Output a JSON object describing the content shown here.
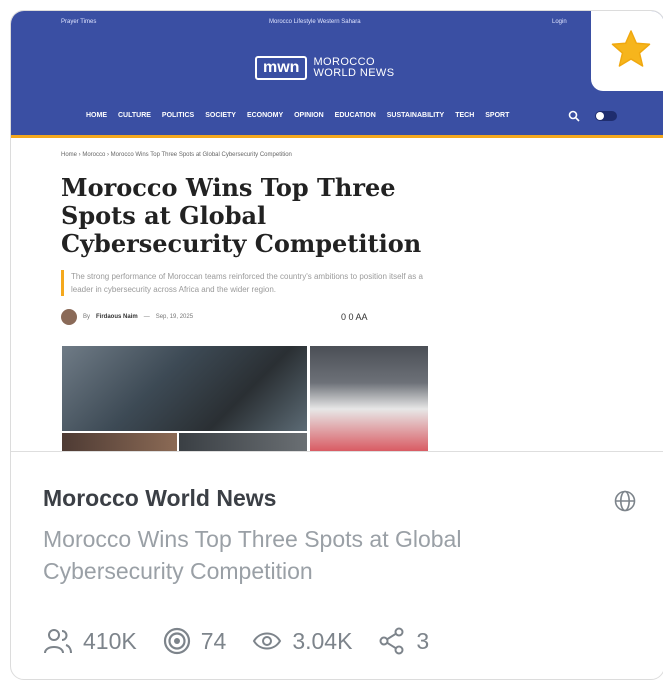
{
  "site": {
    "top_left": "Prayer Times",
    "top_center": "Morocco   Lifestyle   Western Sahara",
    "top_right": "Login",
    "logo_mark": "mwn",
    "logo_text_1": "MOROCCO",
    "logo_text_2": "WORLD NEWS",
    "nav": [
      "HOME",
      "CULTURE",
      "POLITICS",
      "SOCIETY",
      "ECONOMY",
      "OPINION",
      "EDUCATION",
      "SUSTAINABILITY",
      "TECH",
      "SPORT"
    ]
  },
  "article": {
    "breadcrumb": "Home › Morocco › Morocco Wins Top Three Spots at Global Cybersecurity Competition",
    "title": "Morocco Wins Top Three Spots at Global Cybersecurity Competition",
    "lede": "The strong performance of Moroccan teams reinforced the country's ambitions to position itself as a leader in cybersecurity across Africa and the wider region.",
    "by_prefix": "By",
    "author": "Firdaous Naim",
    "date": "Sep, 19, 2025",
    "actions": "0  0  AA"
  },
  "card": {
    "source": "Morocco World News",
    "headline": "Morocco Wins Top Three Spots at Global Cybersecurity Competition",
    "stats": {
      "followers": "410K",
      "reach": "74",
      "views": "3.04K",
      "shares": "3"
    }
  },
  "colors": {
    "header_blue": "#3a4fa3",
    "accent_orange": "#f4a81d",
    "star_yellow": "#f6b51c",
    "muted_text": "#9aa0a6"
  }
}
